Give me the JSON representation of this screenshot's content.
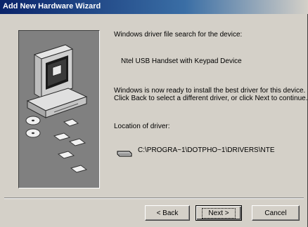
{
  "window": {
    "title": "Add New Hardware Wizard"
  },
  "content": {
    "search_label": "Windows driver file search for the device:",
    "device_name": "Ntel USB Handset with Keypad Device",
    "ready_message": "Windows is now ready to install the best driver for this device. Click Back to select a different driver, or click Next to continue.",
    "location_label": "Location of driver:",
    "driver_path": "C:\\PROGRA~1\\DOTPHO~1\\DRIVERS\\NTE"
  },
  "buttons": {
    "back_label": "< Back",
    "next_label": "Next >",
    "cancel_label": "Cancel"
  },
  "icons": {
    "wizard_graphic": "computer-with-cds-icon",
    "drive": "drive-icon"
  },
  "colors": {
    "titlebar_start": "#0a246a",
    "titlebar_end": "#d4d0c8",
    "dialog_face": "#d4d0c8",
    "wizard_panel": "#808080"
  }
}
